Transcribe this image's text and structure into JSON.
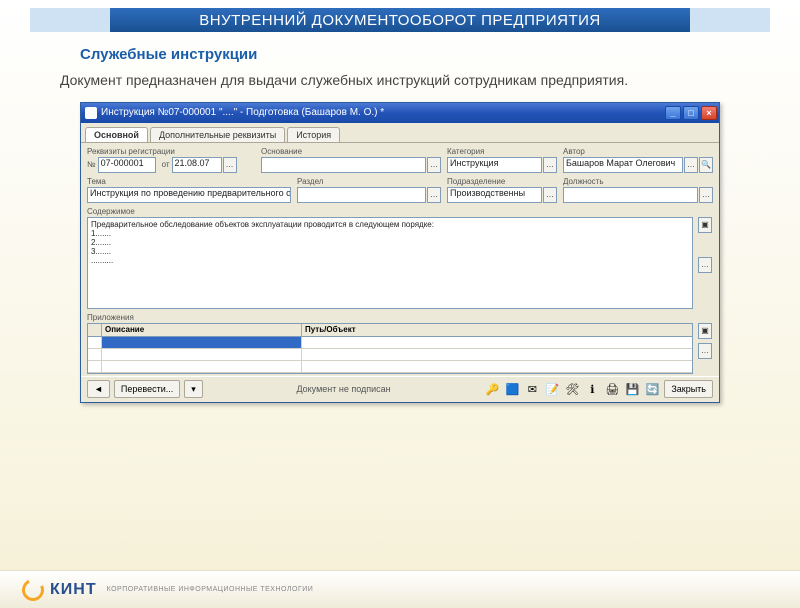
{
  "banner": "ВНУТРЕННИЙ ДОКУМЕНТООБОРОТ ПРЕДПРИЯТИЯ",
  "subtitle": "Служебные инструкции",
  "description": "Документ предназначен для выдачи служебных инструкций сотрудникам предприятия.",
  "window": {
    "title": "Инструкция №07-000001 \"....\" - Подготовка (Башаров М. О.) *",
    "tabs": {
      "main": "Основной",
      "extra": "Дополнительные реквизиты",
      "history": "История"
    },
    "reg_label": "Реквизиты регистрации",
    "fields": {
      "no_prefix": "№",
      "no": "07-000001",
      "date_prefix": "от",
      "date": "21.08.07",
      "basis_label": "Основание",
      "basis": "",
      "category_label": "Категория",
      "category": "Инструкция",
      "author_label": "Автор",
      "author": "Башаров Марат Олегович",
      "subject_label": "Тема",
      "subject": "Инструкция по проведению предварительного об",
      "section_label": "Раздел",
      "section": "",
      "dept_label": "Подразделение",
      "dept": "Производственны",
      "position_label": "Должность",
      "position": ""
    },
    "content_label": "Содержимое",
    "content_text": "Предварительное обследование объектов эксплуатации проводится в следующем порядке:\n1.......\n2.......\n3.......\n..........",
    "attachments_label": "Приложения",
    "att_col_desc": "Описание",
    "att_col_path": "Путь/Объект",
    "status": {
      "translate": "Перевести...",
      "unsigned": "Документ не подписан",
      "close": "Закрыть"
    }
  },
  "brand": {
    "name": "КИНТ",
    "tag": "КОРПОРАТИВНЫЕ ИНФОРМАЦИОННЫЕ ТЕХНОЛОГИИ"
  }
}
